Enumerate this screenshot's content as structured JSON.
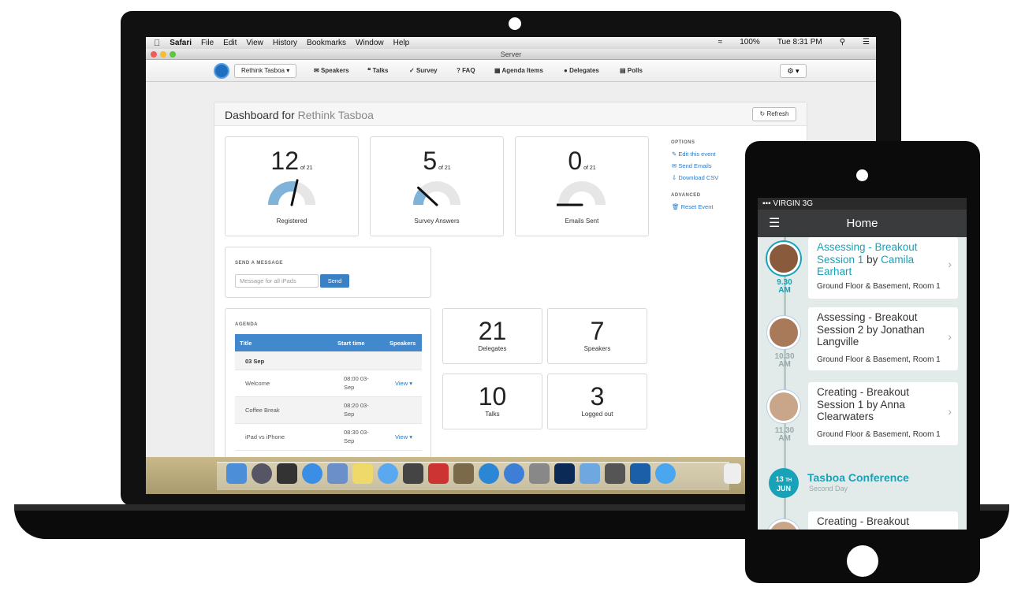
{
  "menubar": {
    "app": "Safari",
    "items": [
      "File",
      "Edit",
      "View",
      "History",
      "Bookmarks",
      "Window",
      "Help"
    ],
    "battery": "100%",
    "clock": "Tue 8:31 PM"
  },
  "window": {
    "title": "Server"
  },
  "nav": {
    "event": "Rethink Tasboa",
    "items": [
      "Speakers",
      "Talks",
      "Survey",
      "FAQ",
      "Agenda Items",
      "Delegates",
      "Polls"
    ]
  },
  "dashboard": {
    "title_prefix": "Dashboard for",
    "event_name": "Rethink Tasboa",
    "refresh": "Refresh"
  },
  "gauges": [
    {
      "value": "12",
      "of": "of 21",
      "label": "Registered",
      "fraction": 0.571
    },
    {
      "value": "5",
      "of": "of 21",
      "label": "Survey Answers",
      "fraction": 0.238
    },
    {
      "value": "0",
      "of": "of 21",
      "label": "Emails Sent",
      "fraction": 0
    }
  ],
  "options": {
    "heading": "OPTIONS",
    "links": [
      "Edit this event",
      "Send Emails",
      "Download CSV"
    ],
    "advanced_heading": "ADVANCED",
    "reset": "Reset Event"
  },
  "message": {
    "heading": "SEND A MESSAGE",
    "placeholder": "Message for all iPads",
    "send": "Send"
  },
  "agenda": {
    "heading": "AGENDA",
    "columns": [
      "Title",
      "Start time",
      "Speakers"
    ],
    "group": "03 Sep",
    "rows": [
      {
        "title": "Welcome",
        "time1": "08:00 03-",
        "time2": "Sep",
        "speakers": "View"
      },
      {
        "title": "Coffee Break",
        "time1": "08:20 03-",
        "time2": "Sep",
        "speakers": ""
      },
      {
        "title": "iPad vs iPhone",
        "time1": "08:30 03-",
        "time2": "Sep",
        "speakers": "View"
      }
    ]
  },
  "stats": [
    {
      "value": "21",
      "label": "Delegates"
    },
    {
      "value": "7",
      "label": "Speakers"
    },
    {
      "value": "10",
      "label": "Talks"
    },
    {
      "value": "3",
      "label": "Logged out"
    }
  ],
  "phone": {
    "carrier": "VIRGIN",
    "network": "3G",
    "title": "Home",
    "sessions": [
      {
        "title": "Assessing - Breakout Session 1",
        "by": "by",
        "speaker": "Camila Earhart",
        "time": "9.30",
        "ampm": "AM",
        "room": "Ground Floor & Basement, Room 1"
      },
      {
        "title": "Assessing - Breakout Session 2",
        "by": "by",
        "speaker": "Jonathan Langville",
        "time": "10.30",
        "ampm": "AM",
        "room": "Ground Floor & Basement, Room 1"
      },
      {
        "title": "Creating - Breakout Session 1",
        "by": "by",
        "speaker": "Anna Clearwaters",
        "time": "11.30",
        "ampm": "AM",
        "room": "Ground Floor & Basement, Room 1"
      },
      {
        "title": "Creating - Breakout",
        "room": ""
      }
    ],
    "date_day": "13",
    "date_suffix": "TH",
    "date_month": "JUN",
    "conference": "Tasboa Conference",
    "conference_sub": "Second Day"
  },
  "colors": {
    "accent": "#17a2b8",
    "primary": "#3b80c5",
    "gauge_fill": "#7fb3d9"
  }
}
